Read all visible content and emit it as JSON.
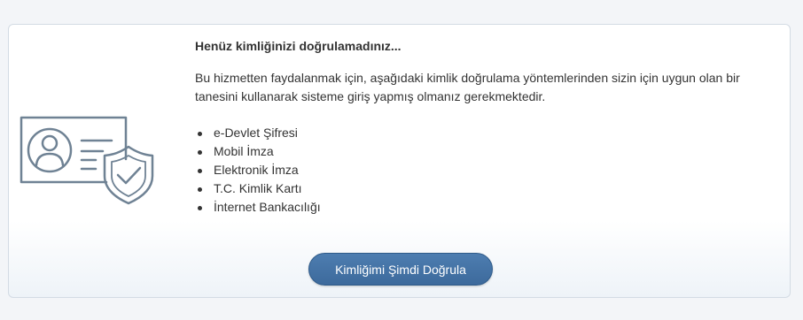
{
  "notice": {
    "title": "Henüz kimliğinizi doğrulamadınız...",
    "description": "Bu hizmetten faydalanmak için, aşağıdaki kimlik doğrulama yöntemlerinden sizin için uygun olan bir tanesini kullanarak sisteme giriş yapmış olmanız gerekmektedir.",
    "methods": [
      "e-Devlet Şifresi",
      "Mobil İmza",
      "Elektronik İmza",
      "T.C. Kimlik Kartı",
      "İnternet Bankacılığı"
    ],
    "verify_button_label": "Kimliğimi Şimdi Doğrula"
  },
  "illustration": {
    "icon": "id-card-shield-icon",
    "color": "#6f8294"
  },
  "colors": {
    "button": "#3f6d9f",
    "card_border": "#d3dbe4"
  }
}
